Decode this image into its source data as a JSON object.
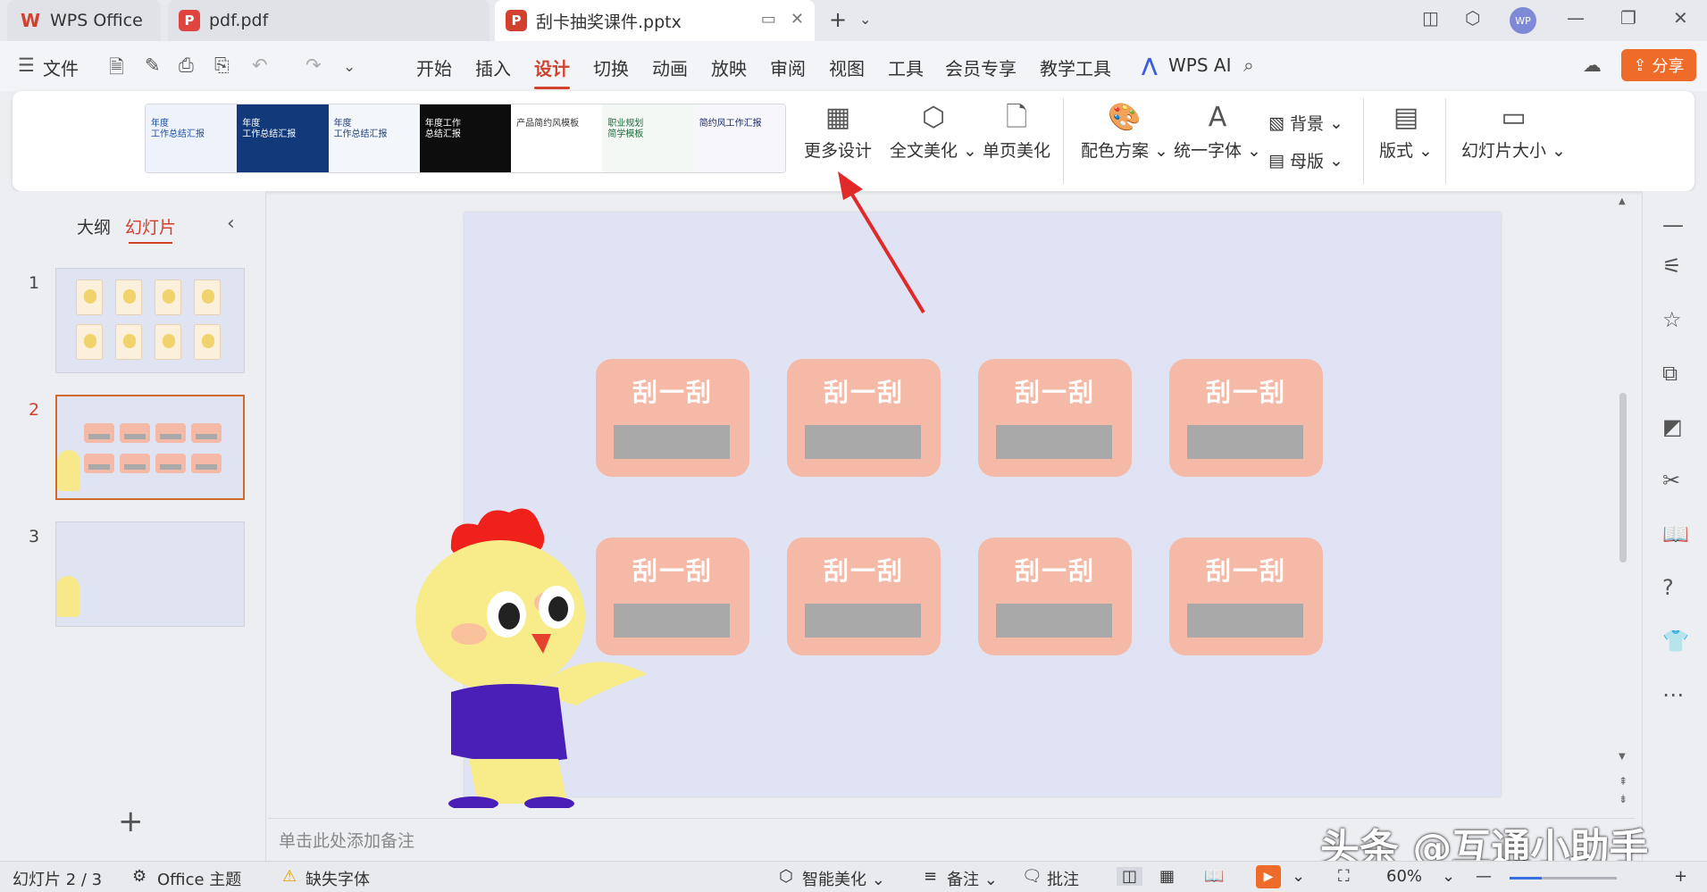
{
  "tabs": [
    {
      "label": "WPS Office",
      "icon": "wps-logo-icon",
      "color": "#d2402e"
    },
    {
      "label": "pdf.pdf",
      "icon": "pdf-icon",
      "color": "#e0443e"
    },
    {
      "label": "刮卡抽奖课件.pptx",
      "icon": "pptx-icon",
      "color": "#d2402e"
    }
  ],
  "avatar": "WP",
  "menu": {
    "file": "文件",
    "items": [
      "开始",
      "插入",
      "设计",
      "切换",
      "动画",
      "放映",
      "审阅",
      "视图",
      "工具",
      "会员专享",
      "教学工具"
    ],
    "active": "设计",
    "wps_ai": "WPS AI",
    "share": "分享"
  },
  "ribbon": {
    "templates": [
      {
        "text": "年度\n工作总结汇报",
        "bg": "#eef3fb",
        "fg": "#1a4fa8"
      },
      {
        "text": "年度\n工作总结汇报",
        "bg": "#123a7a",
        "fg": "#ffffff"
      },
      {
        "text": "年度\n工作总结汇报",
        "bg": "#f3f6fb",
        "fg": "#1f3f7a"
      },
      {
        "text": "年度工作\n总结汇报",
        "bg": "#0d0d0d",
        "fg": "#ffffff"
      },
      {
        "text": "产品简约风模板",
        "bg": "#ffffff",
        "fg": "#333333"
      },
      {
        "text": "职业规划\n简学模板",
        "bg": "#f4f8f4",
        "fg": "#1b6b3a"
      },
      {
        "text": "简约风工作汇报",
        "bg": "#f7f7fb",
        "fg": "#1b2a6b"
      }
    ],
    "more_design": "更多设计",
    "full_beautify": "全文美化",
    "page_beautify": "单页美化",
    "color_scheme": "配色方案",
    "unify_font": "统一字体",
    "background": "背景",
    "master": "母版",
    "layout": "版式",
    "slide_size": "幻灯片大小"
  },
  "left_panel": {
    "outline_tab": "大纲",
    "slides_tab": "幻灯片",
    "slide_numbers": [
      "1",
      "2",
      "3"
    ]
  },
  "slide": {
    "card_text": "刮一刮",
    "card_count": 8,
    "card_color": "#f5b9a7",
    "scratch_color": "#a9a9a9",
    "background": "#dfe3f3"
  },
  "notes_placeholder": "单击此处添加备注",
  "status": {
    "slide_pos": "幻灯片 2 / 3",
    "theme": "Office 主题",
    "missing_font": "缺失字体",
    "smart": "智能美化",
    "notes": "备注",
    "comments": "批注",
    "zoom": "60%",
    "zoom_level": 0.3
  },
  "watermark": "头条 @互通小助手"
}
